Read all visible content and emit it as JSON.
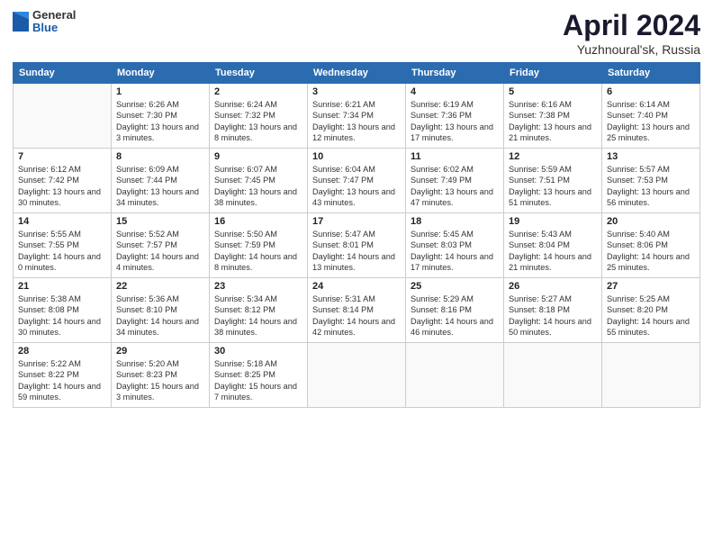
{
  "header": {
    "logo": {
      "general": "General",
      "blue": "Blue"
    },
    "title": "April 2024",
    "location": "Yuzhnoural'sk, Russia"
  },
  "weekdays": [
    "Sunday",
    "Monday",
    "Tuesday",
    "Wednesday",
    "Thursday",
    "Friday",
    "Saturday"
  ],
  "weeks": [
    [
      {
        "day": null
      },
      {
        "day": "1",
        "sunrise": "Sunrise: 6:26 AM",
        "sunset": "Sunset: 7:30 PM",
        "daylight": "Daylight: 13 hours and 3 minutes."
      },
      {
        "day": "2",
        "sunrise": "Sunrise: 6:24 AM",
        "sunset": "Sunset: 7:32 PM",
        "daylight": "Daylight: 13 hours and 8 minutes."
      },
      {
        "day": "3",
        "sunrise": "Sunrise: 6:21 AM",
        "sunset": "Sunset: 7:34 PM",
        "daylight": "Daylight: 13 hours and 12 minutes."
      },
      {
        "day": "4",
        "sunrise": "Sunrise: 6:19 AM",
        "sunset": "Sunset: 7:36 PM",
        "daylight": "Daylight: 13 hours and 17 minutes."
      },
      {
        "day": "5",
        "sunrise": "Sunrise: 6:16 AM",
        "sunset": "Sunset: 7:38 PM",
        "daylight": "Daylight: 13 hours and 21 minutes."
      },
      {
        "day": "6",
        "sunrise": "Sunrise: 6:14 AM",
        "sunset": "Sunset: 7:40 PM",
        "daylight": "Daylight: 13 hours and 25 minutes."
      }
    ],
    [
      {
        "day": "7",
        "sunrise": "Sunrise: 6:12 AM",
        "sunset": "Sunset: 7:42 PM",
        "daylight": "Daylight: 13 hours and 30 minutes."
      },
      {
        "day": "8",
        "sunrise": "Sunrise: 6:09 AM",
        "sunset": "Sunset: 7:44 PM",
        "daylight": "Daylight: 13 hours and 34 minutes."
      },
      {
        "day": "9",
        "sunrise": "Sunrise: 6:07 AM",
        "sunset": "Sunset: 7:45 PM",
        "daylight": "Daylight: 13 hours and 38 minutes."
      },
      {
        "day": "10",
        "sunrise": "Sunrise: 6:04 AM",
        "sunset": "Sunset: 7:47 PM",
        "daylight": "Daylight: 13 hours and 43 minutes."
      },
      {
        "day": "11",
        "sunrise": "Sunrise: 6:02 AM",
        "sunset": "Sunset: 7:49 PM",
        "daylight": "Daylight: 13 hours and 47 minutes."
      },
      {
        "day": "12",
        "sunrise": "Sunrise: 5:59 AM",
        "sunset": "Sunset: 7:51 PM",
        "daylight": "Daylight: 13 hours and 51 minutes."
      },
      {
        "day": "13",
        "sunrise": "Sunrise: 5:57 AM",
        "sunset": "Sunset: 7:53 PM",
        "daylight": "Daylight: 13 hours and 56 minutes."
      }
    ],
    [
      {
        "day": "14",
        "sunrise": "Sunrise: 5:55 AM",
        "sunset": "Sunset: 7:55 PM",
        "daylight": "Daylight: 14 hours and 0 minutes."
      },
      {
        "day": "15",
        "sunrise": "Sunrise: 5:52 AM",
        "sunset": "Sunset: 7:57 PM",
        "daylight": "Daylight: 14 hours and 4 minutes."
      },
      {
        "day": "16",
        "sunrise": "Sunrise: 5:50 AM",
        "sunset": "Sunset: 7:59 PM",
        "daylight": "Daylight: 14 hours and 8 minutes."
      },
      {
        "day": "17",
        "sunrise": "Sunrise: 5:47 AM",
        "sunset": "Sunset: 8:01 PM",
        "daylight": "Daylight: 14 hours and 13 minutes."
      },
      {
        "day": "18",
        "sunrise": "Sunrise: 5:45 AM",
        "sunset": "Sunset: 8:03 PM",
        "daylight": "Daylight: 14 hours and 17 minutes."
      },
      {
        "day": "19",
        "sunrise": "Sunrise: 5:43 AM",
        "sunset": "Sunset: 8:04 PM",
        "daylight": "Daylight: 14 hours and 21 minutes."
      },
      {
        "day": "20",
        "sunrise": "Sunrise: 5:40 AM",
        "sunset": "Sunset: 8:06 PM",
        "daylight": "Daylight: 14 hours and 25 minutes."
      }
    ],
    [
      {
        "day": "21",
        "sunrise": "Sunrise: 5:38 AM",
        "sunset": "Sunset: 8:08 PM",
        "daylight": "Daylight: 14 hours and 30 minutes."
      },
      {
        "day": "22",
        "sunrise": "Sunrise: 5:36 AM",
        "sunset": "Sunset: 8:10 PM",
        "daylight": "Daylight: 14 hours and 34 minutes."
      },
      {
        "day": "23",
        "sunrise": "Sunrise: 5:34 AM",
        "sunset": "Sunset: 8:12 PM",
        "daylight": "Daylight: 14 hours and 38 minutes."
      },
      {
        "day": "24",
        "sunrise": "Sunrise: 5:31 AM",
        "sunset": "Sunset: 8:14 PM",
        "daylight": "Daylight: 14 hours and 42 minutes."
      },
      {
        "day": "25",
        "sunrise": "Sunrise: 5:29 AM",
        "sunset": "Sunset: 8:16 PM",
        "daylight": "Daylight: 14 hours and 46 minutes."
      },
      {
        "day": "26",
        "sunrise": "Sunrise: 5:27 AM",
        "sunset": "Sunset: 8:18 PM",
        "daylight": "Daylight: 14 hours and 50 minutes."
      },
      {
        "day": "27",
        "sunrise": "Sunrise: 5:25 AM",
        "sunset": "Sunset: 8:20 PM",
        "daylight": "Daylight: 14 hours and 55 minutes."
      }
    ],
    [
      {
        "day": "28",
        "sunrise": "Sunrise: 5:22 AM",
        "sunset": "Sunset: 8:22 PM",
        "daylight": "Daylight: 14 hours and 59 minutes."
      },
      {
        "day": "29",
        "sunrise": "Sunrise: 5:20 AM",
        "sunset": "Sunset: 8:23 PM",
        "daylight": "Daylight: 15 hours and 3 minutes."
      },
      {
        "day": "30",
        "sunrise": "Sunrise: 5:18 AM",
        "sunset": "Sunset: 8:25 PM",
        "daylight": "Daylight: 15 hours and 7 minutes."
      },
      {
        "day": null
      },
      {
        "day": null
      },
      {
        "day": null
      },
      {
        "day": null
      }
    ]
  ]
}
